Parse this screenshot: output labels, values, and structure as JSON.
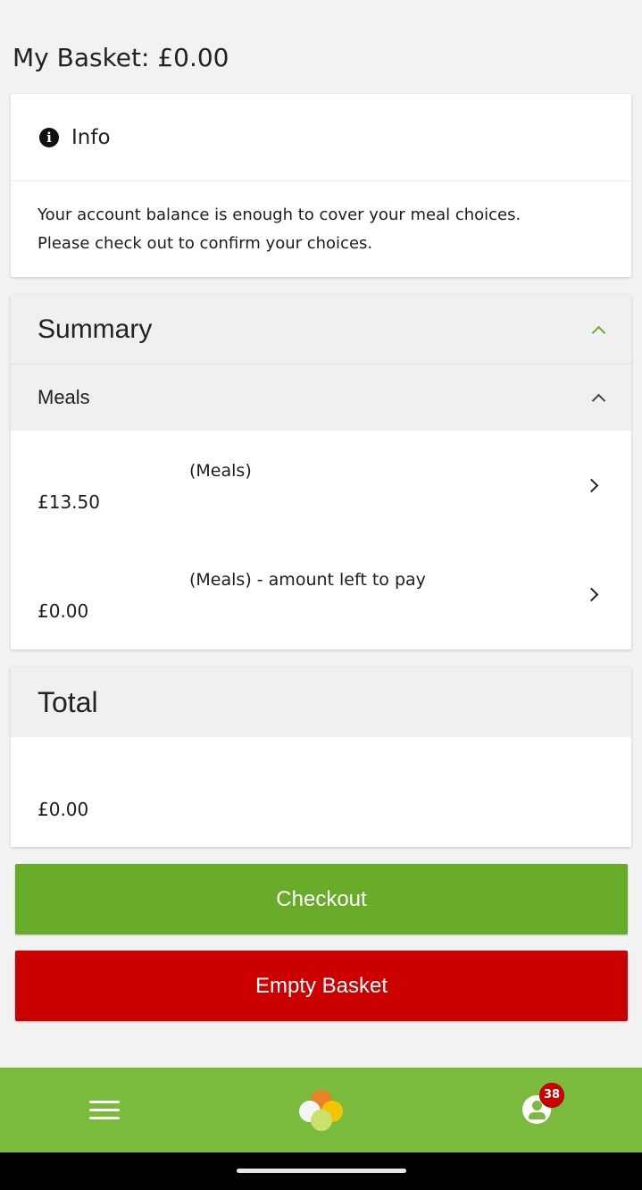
{
  "page": {
    "title": "My Basket: £0.00"
  },
  "info": {
    "icon": "info-icon",
    "title": "Info",
    "message_line1": "Your account balance is enough to cover your meal choices.",
    "message_line2": "Please check out to confirm your choices."
  },
  "summary": {
    "title": "Summary",
    "collapse_icon": "chevron-up-icon",
    "meals": {
      "title": "Meals",
      "items": [
        {
          "label": "(Meals)",
          "price": "£13.50"
        },
        {
          "label": "(Meals) - amount left to pay",
          "price": "£0.00"
        }
      ]
    }
  },
  "total": {
    "title": "Total",
    "value": "£0.00"
  },
  "actions": {
    "checkout_label": "Checkout",
    "empty_label": "Empty Basket"
  },
  "bottom_nav": {
    "menu_icon": "hamburger-menu-icon",
    "logo_icon": "app-logo-icon",
    "profile_icon": "profile-icon",
    "notification_count": "38"
  },
  "colors": {
    "accent_green": "#68ab28",
    "nav_green": "#7aba3c",
    "danger_red": "#cc0000"
  }
}
